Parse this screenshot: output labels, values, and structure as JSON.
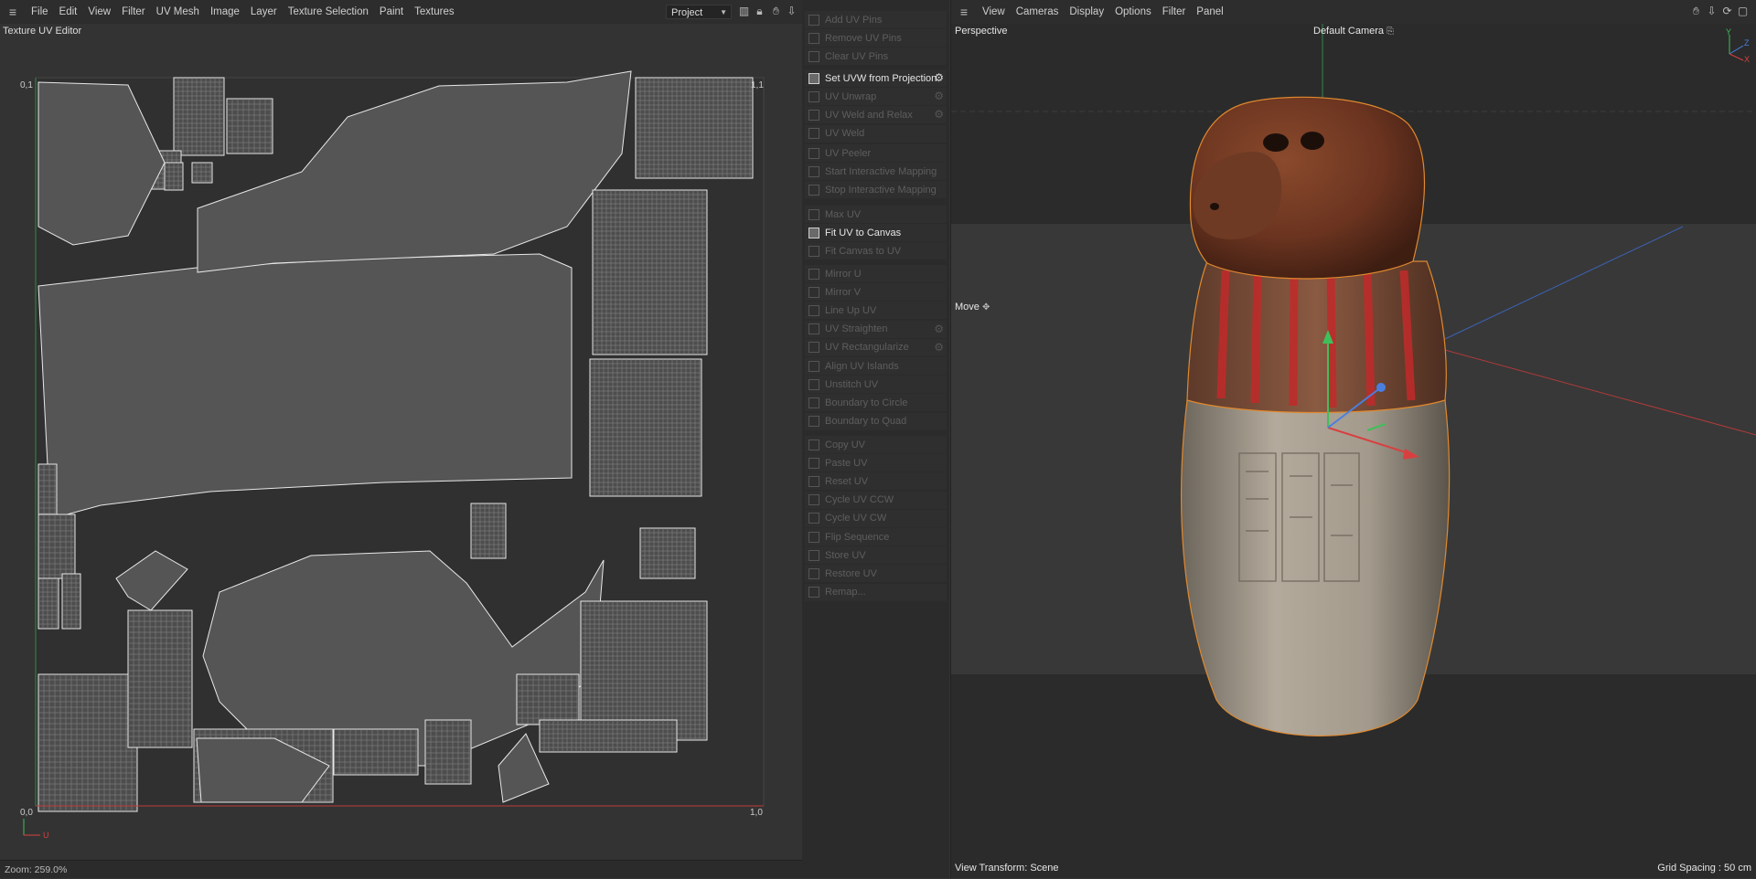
{
  "uv_editor": {
    "menu": [
      "File",
      "Edit",
      "View",
      "Filter",
      "UV Mesh",
      "Image",
      "Layer",
      "Texture Selection",
      "Paint",
      "Textures"
    ],
    "project_select": "Project",
    "toolbar_icons": [
      "graph-icon",
      "lock-icon",
      "hand-pan-icon",
      "move-view-icon"
    ],
    "title": "Texture UV Editor",
    "corner_labels": {
      "top_left": "0,1",
      "top_right": "1,1",
      "bottom_left": "0,0",
      "bottom_right": "1,0"
    },
    "axis_u": "U",
    "status": "Zoom: 259.0%"
  },
  "commands": [
    {
      "label": "Add UV Pins",
      "enabled": false,
      "gear": false
    },
    {
      "label": "Remove UV Pins",
      "enabled": false,
      "gear": false
    },
    {
      "label": "Clear UV Pins",
      "enabled": false,
      "gear": false
    },
    {
      "label": "Set UVW from Projection",
      "enabled": true,
      "gear": true
    },
    {
      "label": "UV Unwrap",
      "enabled": false,
      "gear": true
    },
    {
      "label": "UV Weld and Relax",
      "enabled": false,
      "gear": true
    },
    {
      "label": "UV Weld",
      "enabled": false,
      "gear": false
    },
    {
      "label": "UV Peeler",
      "enabled": false,
      "gear": false
    },
    {
      "label": "Start Interactive Mapping",
      "enabled": false,
      "gear": false
    },
    {
      "label": "Stop Interactive Mapping",
      "enabled": false,
      "gear": false
    },
    {
      "label": "Max UV",
      "enabled": false,
      "gear": false
    },
    {
      "label": "Fit UV to Canvas",
      "enabled": true,
      "gear": false
    },
    {
      "label": "Fit Canvas to UV",
      "enabled": false,
      "gear": false
    },
    {
      "label": "Mirror U",
      "enabled": false,
      "gear": false
    },
    {
      "label": "Mirror V",
      "enabled": false,
      "gear": false
    },
    {
      "label": "Line Up UV",
      "enabled": false,
      "gear": false
    },
    {
      "label": "UV Straighten",
      "enabled": false,
      "gear": true
    },
    {
      "label": "UV Rectangularize",
      "enabled": false,
      "gear": true
    },
    {
      "label": "Align UV Islands",
      "enabled": false,
      "gear": false
    },
    {
      "label": "Unstitch UV",
      "enabled": false,
      "gear": false
    },
    {
      "label": "Boundary to Circle",
      "enabled": false,
      "gear": false
    },
    {
      "label": "Boundary to Quad",
      "enabled": false,
      "gear": false
    },
    {
      "label": "Copy UV",
      "enabled": false,
      "gear": false
    },
    {
      "label": "Paste UV",
      "enabled": false,
      "gear": false
    },
    {
      "label": "Reset UV",
      "enabled": false,
      "gear": false
    },
    {
      "label": "Cycle UV CCW",
      "enabled": false,
      "gear": false
    },
    {
      "label": "Cycle UV CW",
      "enabled": false,
      "gear": false
    },
    {
      "label": "Flip Sequence",
      "enabled": false,
      "gear": false
    },
    {
      "label": "Store UV",
      "enabled": false,
      "gear": false
    },
    {
      "label": "Restore UV",
      "enabled": false,
      "gear": false
    },
    {
      "label": "Remap...",
      "enabled": false,
      "gear": false
    }
  ],
  "viewport": {
    "menu": [
      "View",
      "Cameras",
      "Display",
      "Options",
      "Filter",
      "Panel"
    ],
    "toolbar_icons": [
      "hand-pan-icon",
      "move-view-icon",
      "rotate-view-icon",
      "maximize-icon"
    ],
    "view_name": "Perspective",
    "camera": "Default Camera",
    "tool": "Move",
    "view_transform": "View Transform: Scene",
    "grid_spacing": "Grid Spacing : 50 cm",
    "axis_labels": {
      "y": "Y",
      "z": "Z",
      "x": "X"
    }
  },
  "colors": {
    "accent_orange": "#e0892e",
    "axis_red": "#d84040",
    "axis_green": "#3fbf5a",
    "axis_blue": "#4a7fe0"
  }
}
